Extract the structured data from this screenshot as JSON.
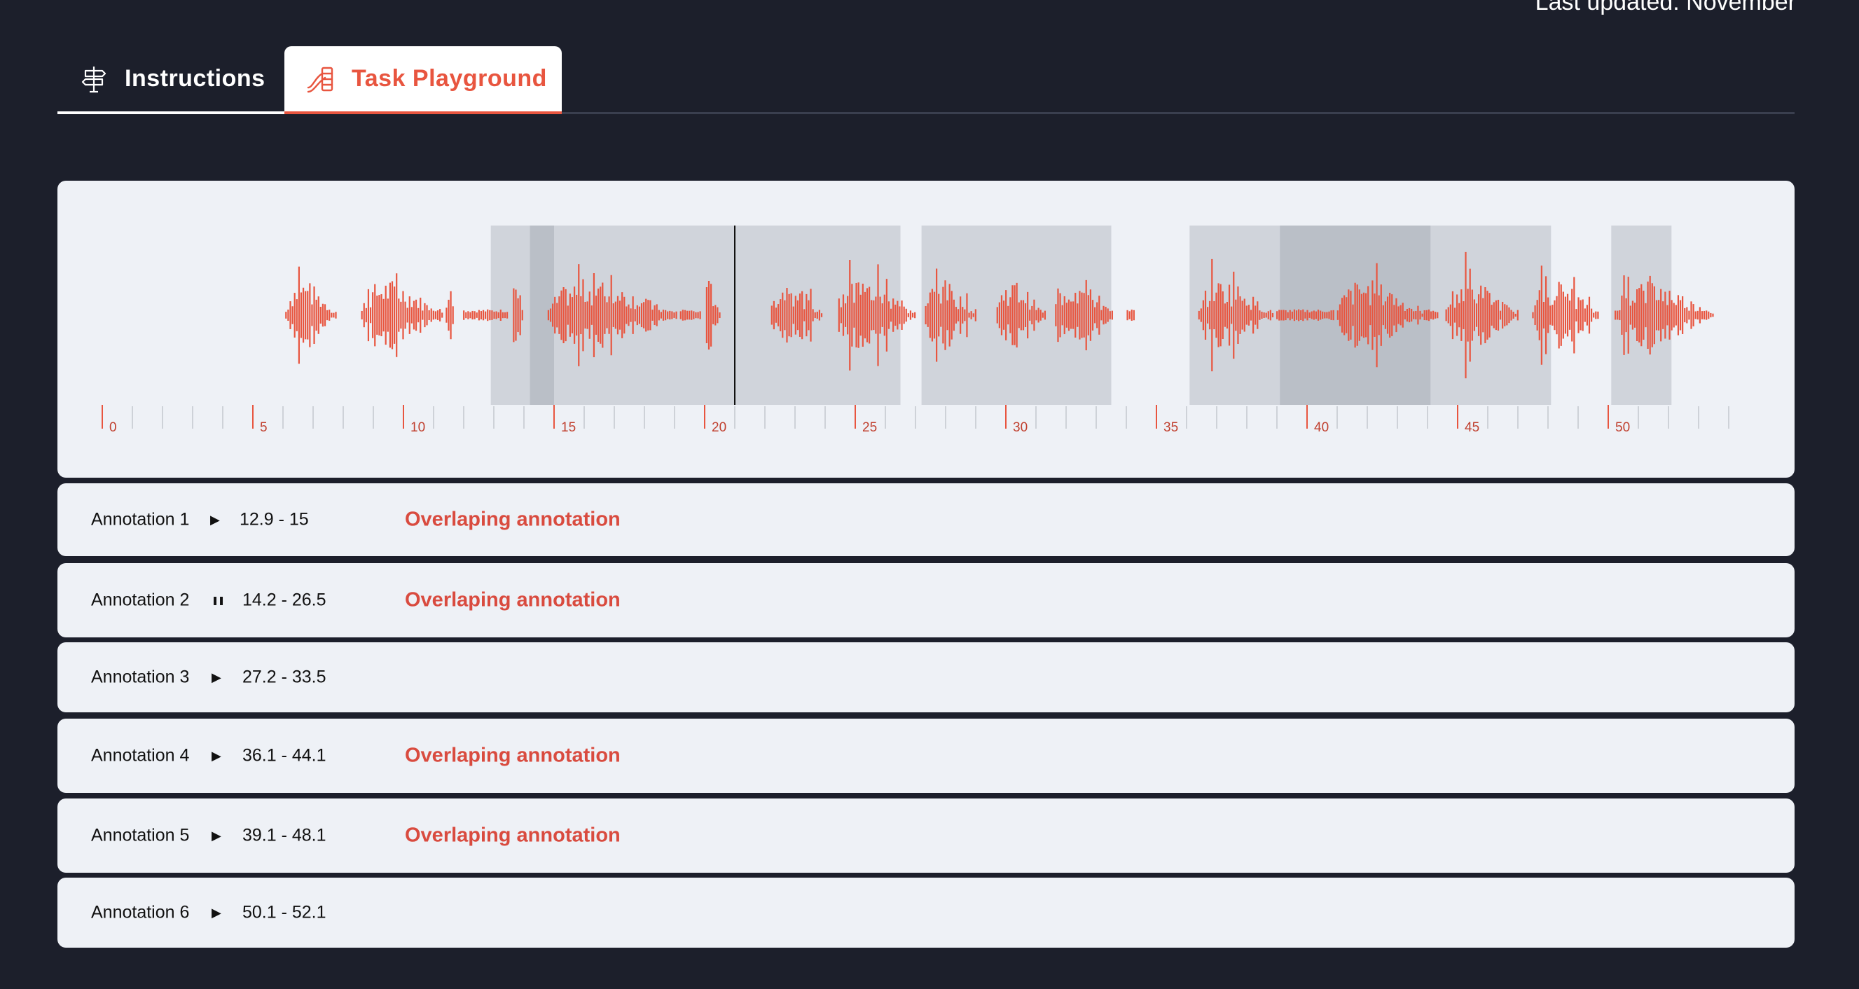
{
  "header": {
    "last_updated": "Last updated: November"
  },
  "tabs": [
    {
      "label": "Instructions",
      "icon": "signpost-icon",
      "active": false
    },
    {
      "label": "Task Playground",
      "icon": "playground-slide-icon",
      "active": true
    }
  ],
  "colors": {
    "background": "#1c1f2b",
    "accent": "#e8553f",
    "panel": "#eef1f6",
    "warning": "#d94b3f"
  },
  "waveform": {
    "timeline_start": 0,
    "timeline_end": 54,
    "tick_labels": [
      "0",
      "5",
      "10",
      "15",
      "20",
      "25",
      "30",
      "35",
      "40",
      "45",
      "50"
    ],
    "playhead_time": 21.0
  },
  "annotations": [
    {
      "name": "Annotation 1",
      "range": "12.9 - 15",
      "start": 12.9,
      "end": 15.0,
      "state": "play",
      "icon": "play-icon",
      "warning": "Overlaping annotation"
    },
    {
      "name": "Annotation 2",
      "range": "14.2 - 26.5",
      "start": 14.2,
      "end": 26.5,
      "state": "pause",
      "icon": "pause-icon",
      "warning": "Overlaping annotation"
    },
    {
      "name": "Annotation 3",
      "range": "27.2 - 33.5",
      "start": 27.2,
      "end": 33.5,
      "state": "play",
      "icon": "play-icon",
      "warning": ""
    },
    {
      "name": "Annotation 4",
      "range": "36.1 - 44.1",
      "start": 36.1,
      "end": 44.1,
      "state": "play",
      "icon": "play-icon",
      "warning": "Overlaping annotation"
    },
    {
      "name": "Annotation 5",
      "range": "39.1 - 48.1",
      "start": 39.1,
      "end": 48.1,
      "state": "play",
      "icon": "play-icon",
      "warning": "Overlaping annotation"
    },
    {
      "name": "Annotation 6",
      "range": "50.1 - 52.1",
      "start": 50.1,
      "end": 52.1,
      "state": "play",
      "icon": "play-icon",
      "warning": ""
    }
  ]
}
